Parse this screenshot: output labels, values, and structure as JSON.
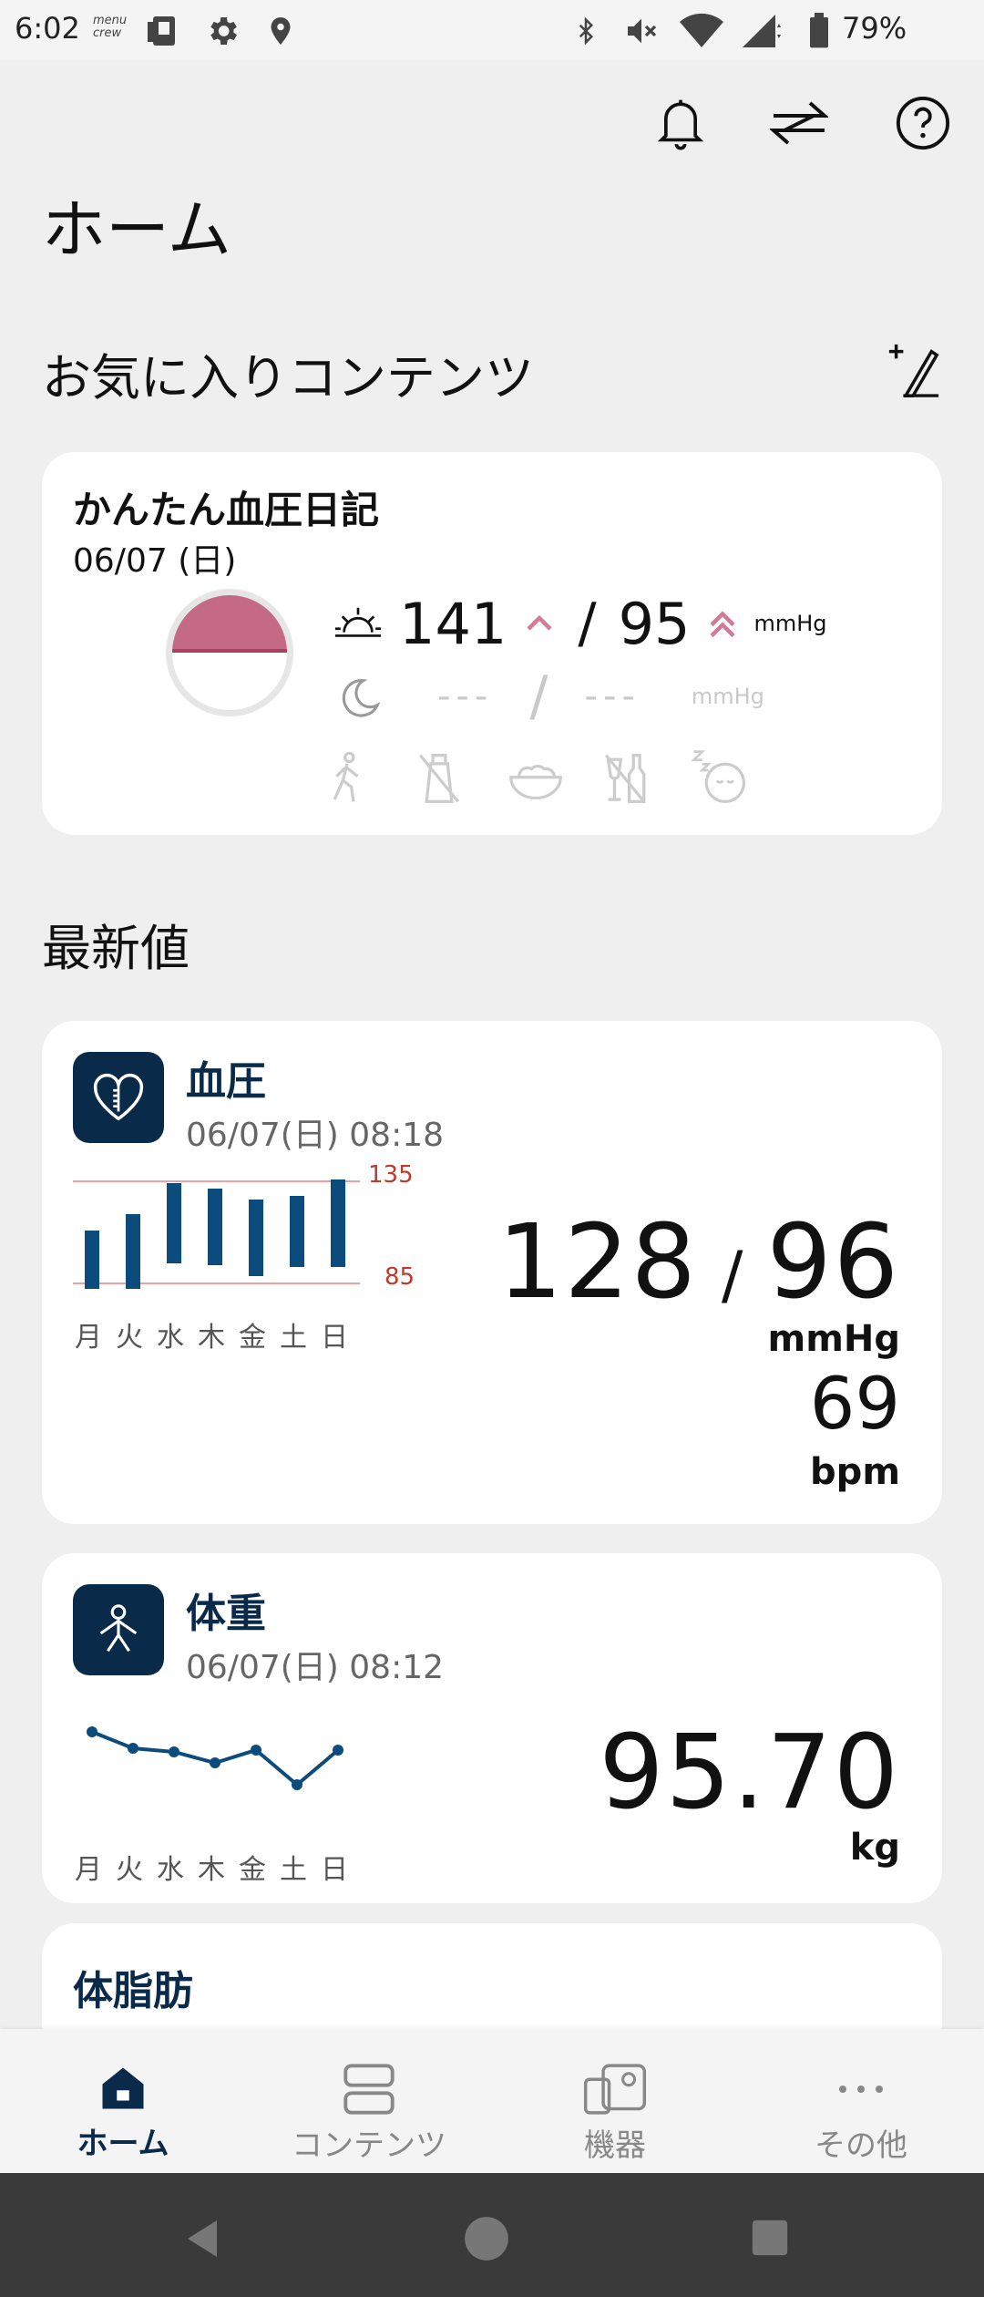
{
  "status_bar": {
    "time": "6:02",
    "crew_label": "menu crew",
    "battery": "79%"
  },
  "page": {
    "title": "ホーム"
  },
  "favorites": {
    "title": "お気に入りコンテンツ",
    "diary": {
      "title": "かんたん血圧日記",
      "date": "06/07 (日)",
      "morning": {
        "systolic": "141",
        "slash": "/",
        "diastolic": "95",
        "unit": "mmHg"
      },
      "evening": {
        "systolic": "---",
        "slash": "/",
        "diastolic": "---",
        "unit": "mmHg"
      }
    }
  },
  "latest": {
    "title": "最新値",
    "blood_pressure": {
      "title": "血圧",
      "time": "06/07(日) 08:18",
      "upper_limit": "135",
      "lower_limit": "85",
      "days": [
        "月",
        "火",
        "水",
        "木",
        "金",
        "土",
        "日"
      ],
      "systolic": "128",
      "slash": "/",
      "diastolic": "96",
      "unit": "mmHg",
      "pulse": "69",
      "pulse_unit": "bpm"
    },
    "weight": {
      "title": "体重",
      "time": "06/07(日) 08:12",
      "days": [
        "月",
        "火",
        "水",
        "木",
        "金",
        "土",
        "日"
      ],
      "value": "95.70",
      "unit": "kg"
    },
    "body_fat": {
      "title": "体脂肪"
    }
  },
  "nav": {
    "items": [
      {
        "label": "ホーム"
      },
      {
        "label": "コンテンツ"
      },
      {
        "label": "機器"
      },
      {
        "label": "その他"
      }
    ]
  },
  "colors": {
    "navy": "#0a2a4a",
    "bp_bar": "#0b4c7c",
    "limit_line": "#e8a0a0",
    "accent_pink": "#c46a86"
  }
}
